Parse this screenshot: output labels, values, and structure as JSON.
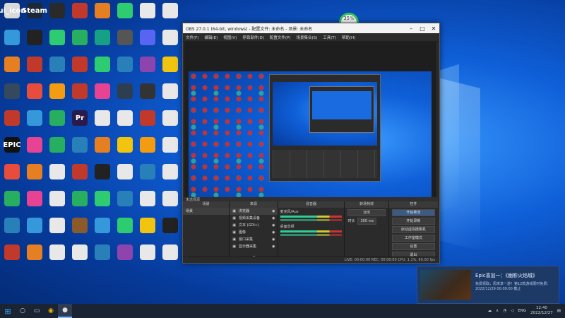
{
  "watermark": "",
  "desktop_icons": [
    {
      "label": "ui_icon",
      "color": "#d9d9d9"
    },
    {
      "label": "Steam",
      "color": "#1b2838"
    },
    {
      "label": "",
      "color": "#2a2a2a"
    },
    {
      "label": "",
      "color": "#c0392b"
    },
    {
      "label": "",
      "color": "#e67e22"
    },
    {
      "label": "",
      "color": "#2ecc71"
    },
    {
      "label": "",
      "color": "#e8e8e8"
    },
    {
      "label": "",
      "color": "#e8e8e8"
    },
    {
      "label": "",
      "color": "#3498db"
    },
    {
      "label": "",
      "color": "#222"
    },
    {
      "label": "",
      "color": "#2ecc71"
    },
    {
      "label": "",
      "color": "#27ae60"
    },
    {
      "label": "",
      "color": "#16a085"
    },
    {
      "label": "",
      "color": "#555"
    },
    {
      "label": "",
      "color": "#5865f2"
    },
    {
      "label": "",
      "color": "#e8e8e8"
    },
    {
      "label": "",
      "color": "#e67e22"
    },
    {
      "label": "",
      "color": "#c0392b"
    },
    {
      "label": "",
      "color": "#2980b9"
    },
    {
      "label": "",
      "color": "#c0392b"
    },
    {
      "label": "",
      "color": "#2ecc71"
    },
    {
      "label": "",
      "color": "#2980b9"
    },
    {
      "label": "",
      "color": "#8e44ad"
    },
    {
      "label": "",
      "color": "#f1c40f"
    },
    {
      "label": "",
      "color": "#34495e"
    },
    {
      "label": "",
      "color": "#e74c3c"
    },
    {
      "label": "",
      "color": "#f39c12"
    },
    {
      "label": "",
      "color": "#c0392b"
    },
    {
      "label": "",
      "color": "#e84393"
    },
    {
      "label": "",
      "color": "#2c3e50"
    },
    {
      "label": "",
      "color": "#333"
    },
    {
      "label": "",
      "color": "#e8e8e8"
    },
    {
      "label": "",
      "color": "#c0392b"
    },
    {
      "label": "",
      "color": "#3498db"
    },
    {
      "label": "",
      "color": "#27ae60"
    },
    {
      "label": "Pr",
      "color": "#2a1b4a"
    },
    {
      "label": "",
      "color": "#e8e8e8"
    },
    {
      "label": "",
      "color": "#e8e8e8"
    },
    {
      "label": "",
      "color": "#c0392b"
    },
    {
      "label": "",
      "color": "#e8e8e8"
    },
    {
      "label": "EPIC",
      "color": "#111"
    },
    {
      "label": "",
      "color": "#e84393"
    },
    {
      "label": "",
      "color": "#27ae60"
    },
    {
      "label": "",
      "color": "#2980b9"
    },
    {
      "label": "",
      "color": "#e67e22"
    },
    {
      "label": "",
      "color": "#f1c40f"
    },
    {
      "label": "",
      "color": "#f39c12"
    },
    {
      "label": "",
      "color": "#e8e8e8"
    },
    {
      "label": "",
      "color": "#e74c3c"
    },
    {
      "label": "",
      "color": "#e67e22"
    },
    {
      "label": "",
      "color": "#e8e8e8"
    },
    {
      "label": "",
      "color": "#c0392b"
    },
    {
      "label": "",
      "color": "#222"
    },
    {
      "label": "",
      "color": "#e8e8e8"
    },
    {
      "label": "",
      "color": "#2980b9"
    },
    {
      "label": "",
      "color": "#e8e8e8"
    },
    {
      "label": "",
      "color": "#27ae60"
    },
    {
      "label": "",
      "color": "#e84393"
    },
    {
      "label": "",
      "color": "#e8e8e8"
    },
    {
      "label": "",
      "color": "#27ae60"
    },
    {
      "label": "",
      "color": "#2ecc71"
    },
    {
      "label": "",
      "color": "#2980b9"
    },
    {
      "label": "",
      "color": "#e8e8e8"
    },
    {
      "label": "",
      "color": "#e8e8e8"
    },
    {
      "label": "",
      "color": "#2980b9"
    },
    {
      "label": "",
      "color": "#3498db"
    },
    {
      "label": "",
      "color": "#e8e8e8"
    },
    {
      "label": "",
      "color": "#8b5a2b"
    },
    {
      "label": "",
      "color": "#3498db"
    },
    {
      "label": "",
      "color": "#2ecc71"
    },
    {
      "label": "",
      "color": "#f1c40f"
    },
    {
      "label": "",
      "color": "#222"
    },
    {
      "label": "",
      "color": "#c0392b"
    },
    {
      "label": "",
      "color": "#e67e22"
    },
    {
      "label": "",
      "color": "#e8e8e8"
    },
    {
      "label": "",
      "color": "#e8e8e8"
    },
    {
      "label": "",
      "color": "#2980b9"
    },
    {
      "label": "",
      "color": "#8e44ad"
    },
    {
      "label": "",
      "color": "#e8e8e8"
    },
    {
      "label": "",
      "color": "#e8e8e8"
    }
  ],
  "perf": {
    "value": "35%",
    "sub": "4.2K/s"
  },
  "obs": {
    "title": "OBS 27.0.1 (64-bit, windows) - 配置文件: 未命名 - 场景: 未命名",
    "menu": [
      "文件(F)",
      "编辑(E)",
      "视图(V)",
      "停靠部件(D)",
      "配置文件(P)",
      "场景集合(S)",
      "工具(T)",
      "帮助(H)"
    ],
    "scene_bar": "未选择源",
    "docks": {
      "scenes": {
        "title": "场景",
        "items": [
          "场景"
        ]
      },
      "sources": {
        "title": "来源",
        "items": [
          "浏览器",
          "视频采集设备",
          "文本 (GDI+)",
          "图像",
          "窗口采集",
          "显示器采集"
        ]
      },
      "mixer": {
        "title": "混音器",
        "channels": [
          "麦克风/Aux",
          "桌面音频"
        ]
      },
      "transitions": {
        "title": "转场特效",
        "type": "淡出",
        "duration_label": "时长",
        "duration": "300 ms"
      },
      "controls": {
        "title": "控件",
        "buttons": [
          "开始推流",
          "开始录制",
          "启动虚拟摄像机",
          "工作室模式",
          "设置",
          "退出"
        ]
      }
    },
    "status": "LIVE: 00:00:00   REC: 00:00:00   CPU: 1.1%, 60.00 fps"
  },
  "toast": {
    "title": "Epic喜加一：《幽影火焰城》",
    "body": "免费领取，周末享一游！第12款游戏限时免费：2022/12/29 00:00:00 截止"
  },
  "taskbar": {
    "tray": "ENG",
    "time": "12:40",
    "date": "2022/12/27"
  }
}
